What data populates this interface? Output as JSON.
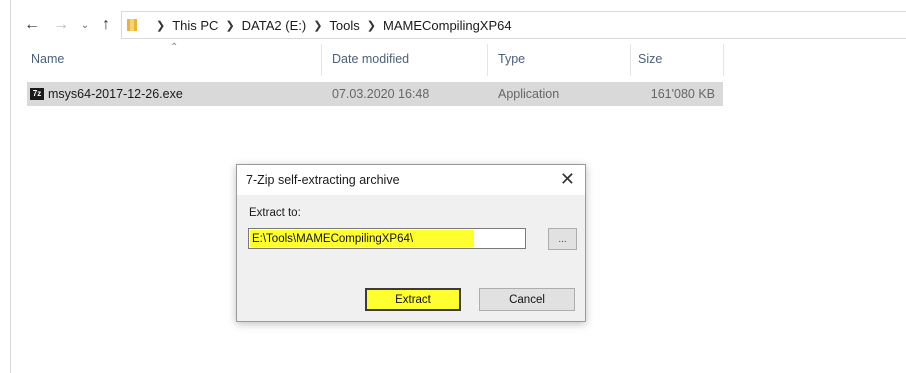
{
  "navigation": {
    "back_icon": "back-arrow-icon",
    "forward_icon": "forward-arrow-icon",
    "recent_icon": "chevron-down-icon",
    "up_icon": "up-arrow-icon",
    "breadcrumb": [
      "This PC",
      "DATA2 (E:)",
      "Tools",
      "MAMECompilingXP64"
    ]
  },
  "columns": {
    "name": "Name",
    "date_modified": "Date modified",
    "type": "Type",
    "size": "Size"
  },
  "files": [
    {
      "name": "msys64-2017-12-26.exe",
      "date_modified": "07.03.2020 16:48",
      "type": "Application",
      "size": "161'080 KB",
      "icon_text": "7z"
    }
  ],
  "dialog": {
    "title": "7-Zip self-extracting archive",
    "close_icon": "close-icon",
    "extract_label": "Extract to:",
    "path_value": "E:\\Tools\\MAMECompilingXP64\\",
    "browse_label": "...",
    "extract_button": "Extract",
    "cancel_button": "Cancel",
    "highlight_color": "#ffff2f"
  }
}
